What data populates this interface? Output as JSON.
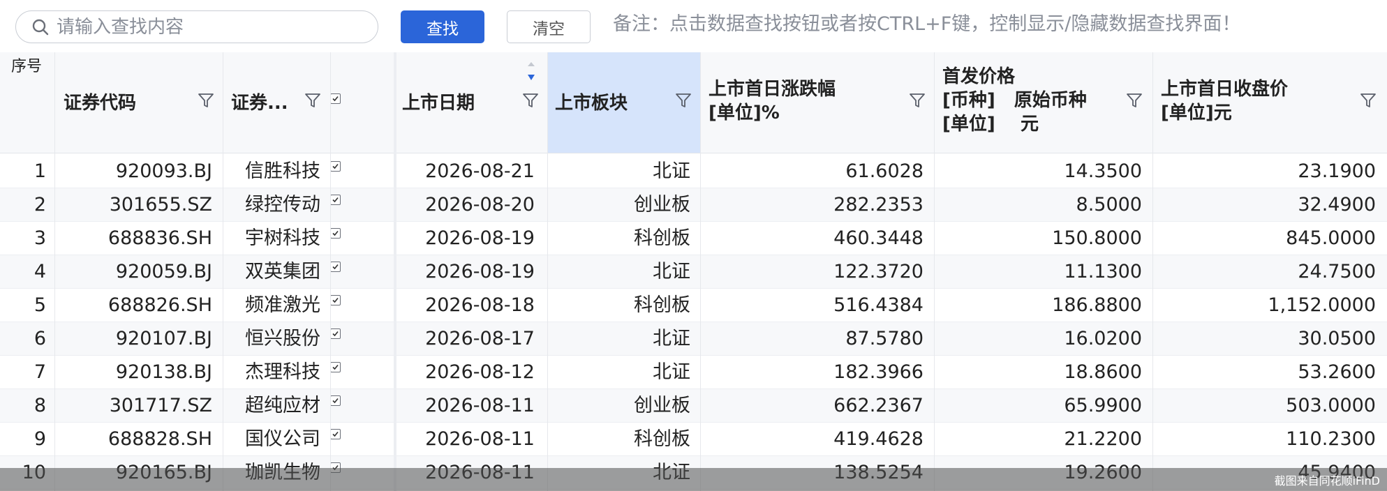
{
  "toolbar": {
    "search_placeholder": "请输入查找内容",
    "find_label": "查找",
    "clear_label": "清空",
    "note": "备注：点击数据查找按钮或者按CTRL+F键，控制显示/隐藏数据查找界面！"
  },
  "columns": {
    "index": "序号",
    "code": "证券代码",
    "name": "证券...",
    "date": "上市日期",
    "board": "上市板块",
    "change_l1": "上市首日涨跌幅",
    "change_l2": "[单位]%",
    "price_l1": "首发价格",
    "price_l2": "[币种]   原始币种",
    "price_l3": "[单位]    元",
    "close_l1": "上市首日收盘价",
    "close_l2": "[单位]元"
  },
  "rows": [
    {
      "idx": "1",
      "code": "920093.BJ",
      "name": "信胜科技",
      "date": "2026-08-21",
      "board": "北证",
      "change": "61.6028",
      "price": "14.3500",
      "close": "23.1900"
    },
    {
      "idx": "2",
      "code": "301655.SZ",
      "name": "绿控传动",
      "date": "2026-08-20",
      "board": "创业板",
      "change": "282.2353",
      "price": "8.5000",
      "close": "32.4900"
    },
    {
      "idx": "3",
      "code": "688836.SH",
      "name": "宇树科技",
      "date": "2026-08-19",
      "board": "科创板",
      "change": "460.3448",
      "price": "150.8000",
      "close": "845.0000"
    },
    {
      "idx": "4",
      "code": "920059.BJ",
      "name": "双英集团",
      "date": "2026-08-19",
      "board": "北证",
      "change": "122.3720",
      "price": "11.1300",
      "close": "24.7500"
    },
    {
      "idx": "5",
      "code": "688826.SH",
      "name": "频准激光",
      "date": "2026-08-18",
      "board": "科创板",
      "change": "516.4384",
      "price": "186.8800",
      "close": "1,152.0000"
    },
    {
      "idx": "6",
      "code": "920107.BJ",
      "name": "恒兴股份",
      "date": "2026-08-17",
      "board": "北证",
      "change": "87.5780",
      "price": "16.0200",
      "close": "30.0500"
    },
    {
      "idx": "7",
      "code": "920138.BJ",
      "name": "杰理科技",
      "date": "2026-08-12",
      "board": "北证",
      "change": "182.3966",
      "price": "18.8600",
      "close": "53.2600"
    },
    {
      "idx": "8",
      "code": "301717.SZ",
      "name": "超纯应材",
      "date": "2026-08-11",
      "board": "创业板",
      "change": "662.2367",
      "price": "65.9900",
      "close": "503.0000"
    },
    {
      "idx": "9",
      "code": "688828.SH",
      "name": "国仪公司",
      "date": "2026-08-11",
      "board": "科创板",
      "change": "419.4628",
      "price": "21.2200",
      "close": "110.2300"
    },
    {
      "idx": "10",
      "code": "920165.BJ",
      "name": "珈凯生物",
      "date": "2026-08-11",
      "board": "北证",
      "change": "138.5254",
      "price": "19.2600",
      "close": "45.9400"
    }
  ],
  "footer": {
    "watermark": "截图来自同花顺iFinD"
  },
  "colors": {
    "accent": "#2b65d9",
    "selected_header": "#d6e4fb"
  }
}
